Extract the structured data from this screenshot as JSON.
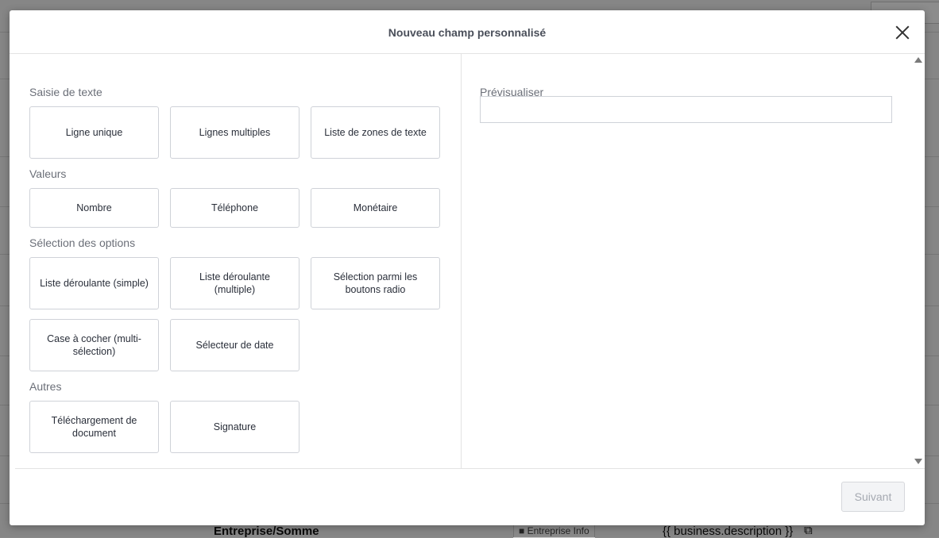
{
  "background": {
    "bottom_row_text": "Entreprise/Somme",
    "bottom_row_chip": "Entreprise Info",
    "bottom_row_token": "{{ business.description }}"
  },
  "modal": {
    "title": "Nouveau champ personnalisé",
    "sections": [
      {
        "label": "Saisie de texte",
        "options": [
          "Ligne unique",
          "Lignes multiples",
          "Liste de zones de texte"
        ]
      },
      {
        "label": "Valeurs",
        "options": [
          "Nombre",
          "Téléphone",
          "Monétaire"
        ]
      },
      {
        "label": "Sélection des options",
        "options": [
          "Liste déroulante (simple)",
          "Liste déroulante (multiple)",
          "Sélection parmi les boutons radio",
          "Case à cocher (multi-sélection)",
          "Sélecteur de date"
        ]
      },
      {
        "label": "Autres",
        "options": [
          "Téléchargement de document",
          "Signature"
        ]
      }
    ],
    "preview": {
      "label": "Prévisualiser",
      "value": ""
    },
    "next_label": "Suivant"
  }
}
